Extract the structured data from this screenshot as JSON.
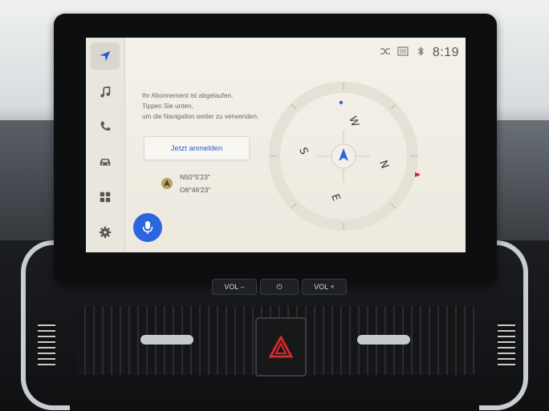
{
  "status": {
    "time": "8:19",
    "icons": [
      "shuffle-icon",
      "sim-icon",
      "bluetooth-icon"
    ]
  },
  "sidebar": {
    "items": [
      {
        "name": "navigation",
        "icon": "navigation-arrow-icon",
        "active": true
      },
      {
        "name": "music",
        "icon": "music-note-icon",
        "active": false
      },
      {
        "name": "phone",
        "icon": "phone-icon",
        "active": false
      },
      {
        "name": "car",
        "icon": "car-icon",
        "active": false
      },
      {
        "name": "apps",
        "icon": "apps-grid-icon",
        "active": false
      },
      {
        "name": "settings",
        "icon": "gear-icon",
        "active": false
      }
    ]
  },
  "message": {
    "line1": "Ihr Abonnement ist abgelaufen.",
    "line2": "Tippen Sie unten,",
    "line3": "um die Navigation weiter zu verwenden."
  },
  "login_button": "Jetzt anmelden",
  "location": {
    "lat": "N50°5'23\"",
    "lon": "O8°46'23\""
  },
  "compass": {
    "labels": [
      "W",
      "N",
      "S",
      "E"
    ]
  },
  "hardware": {
    "vol_down": "VOL –",
    "power": "⏻",
    "vol_up": "VOL +"
  },
  "colors": {
    "accent": "#2b66e0",
    "link": "#2c5fcc",
    "hazard": "#d8262a"
  }
}
